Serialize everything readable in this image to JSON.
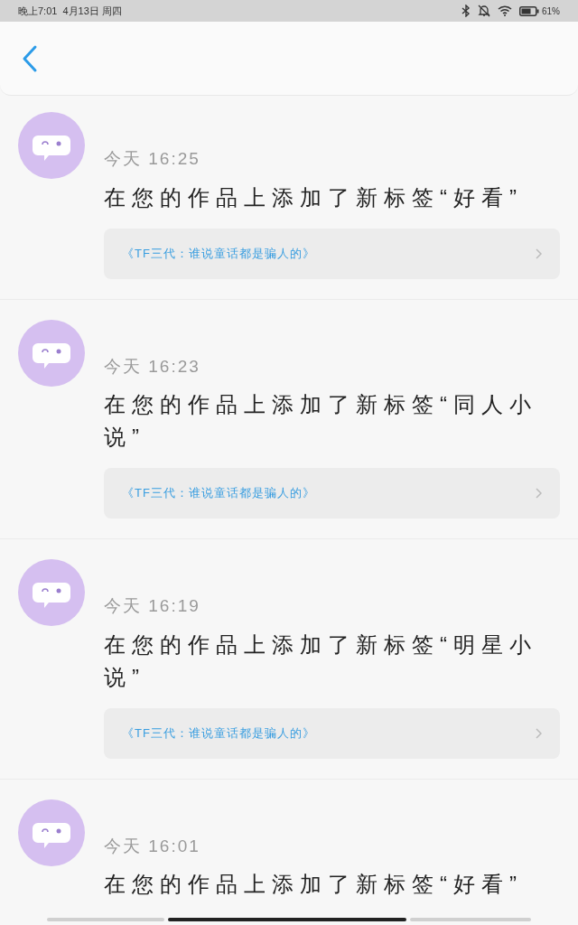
{
  "status_bar": {
    "time": "晚上7:01",
    "date": "4月13日 周四",
    "battery": "61%"
  },
  "notifications": [
    {
      "time": "今天 16:25",
      "message": "在您的作品上添加了新标签“好看”",
      "work": "《TF三代：谁说童话都是骗人的》"
    },
    {
      "time": "今天 16:23",
      "message": "在您的作品上添加了新标签“同人小说”",
      "work": "《TF三代：谁说童话都是骗人的》"
    },
    {
      "time": "今天 16:19",
      "message": "在您的作品上添加了新标签“明星小说”",
      "work": "《TF三代：谁说童话都是骗人的》"
    },
    {
      "time": "今天 16:01",
      "message": "在您的作品上添加了新标签“好看”"
    }
  ]
}
